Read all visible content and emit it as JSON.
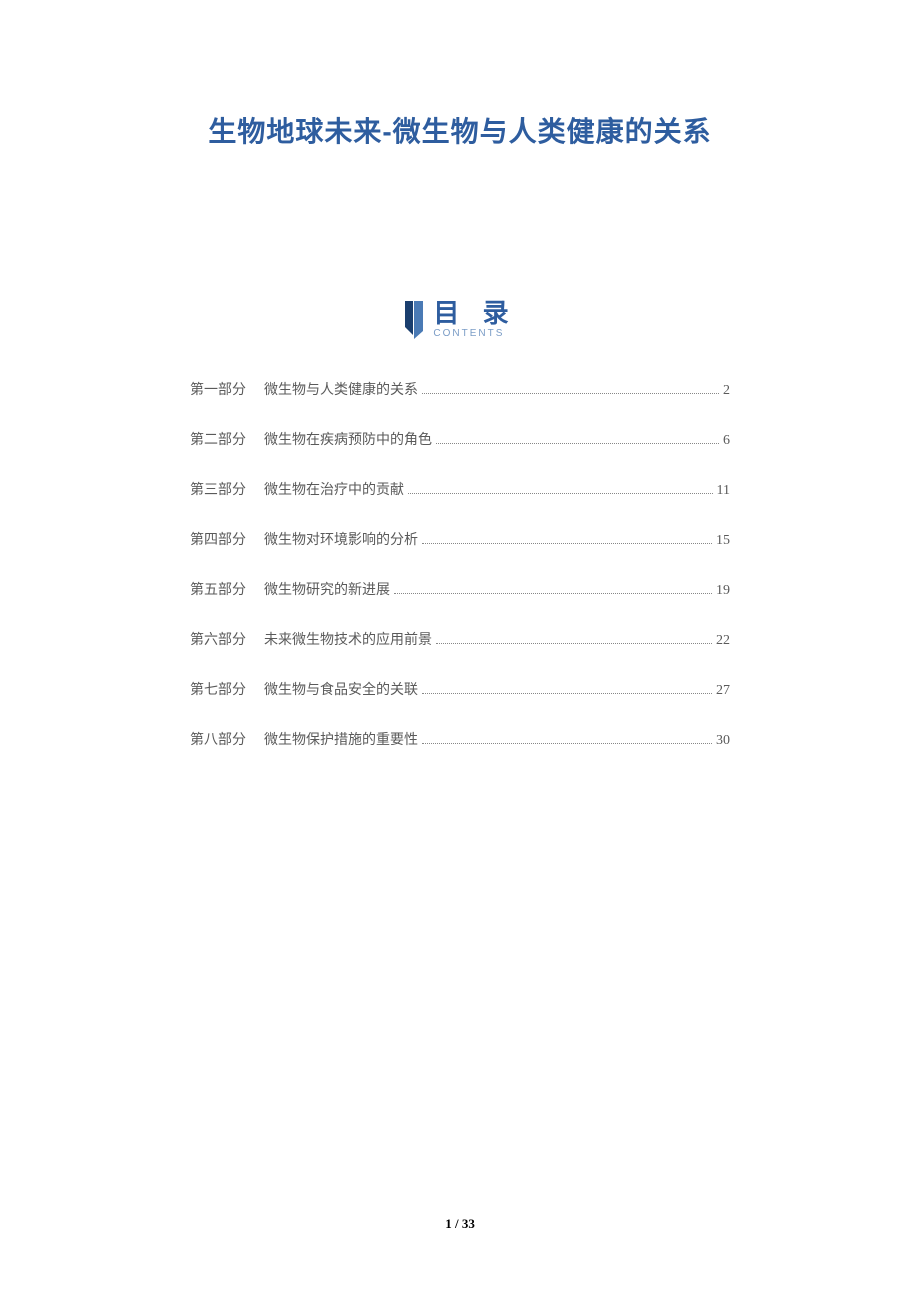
{
  "title": "生物地球未来-微生物与人类健康的关系",
  "toc": {
    "label": "目 录",
    "subtitle": "CONTENTS",
    "items": [
      {
        "part": "第一部分",
        "title": "微生物与人类健康的关系",
        "page": "2"
      },
      {
        "part": "第二部分",
        "title": "微生物在疾病预防中的角色",
        "page": "6"
      },
      {
        "part": "第三部分",
        "title": "微生物在治疗中的贡献",
        "page": "11"
      },
      {
        "part": "第四部分",
        "title": "微生物对环境影响的分析",
        "page": "15"
      },
      {
        "part": "第五部分",
        "title": "微生物研究的新进展",
        "page": "19"
      },
      {
        "part": "第六部分",
        "title": "未来微生物技术的应用前景",
        "page": "22"
      },
      {
        "part": "第七部分",
        "title": "微生物与食品安全的关联",
        "page": "27"
      },
      {
        "part": "第八部分",
        "title": "微生物保护措施的重要性",
        "page": "30"
      }
    ]
  },
  "footer": {
    "current": "1",
    "sep": " / ",
    "total": "33"
  }
}
